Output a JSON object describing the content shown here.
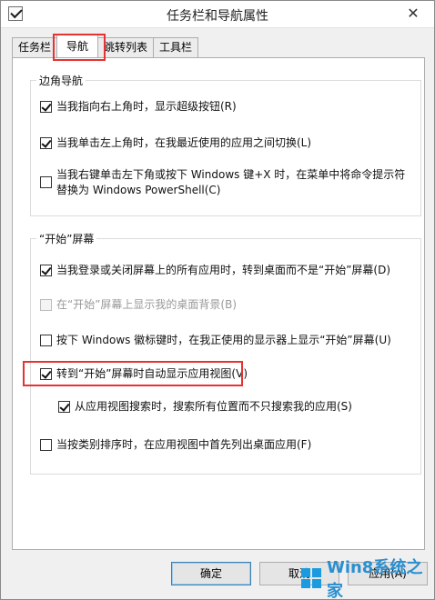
{
  "window": {
    "title": "任务栏和导航属性",
    "close_glyph": "✕"
  },
  "tabs": [
    {
      "label": "任务栏"
    },
    {
      "label": "导航"
    },
    {
      "label": "跳转列表"
    },
    {
      "label": "工具栏"
    }
  ],
  "corner_nav": {
    "title": "边角导航",
    "options": [
      {
        "label": "当我指向右上角时，显示超级按钮(R)",
        "checked": true
      },
      {
        "label": "当我单击左上角时，在我最近使用的应用之间切换(L)",
        "checked": true
      },
      {
        "label": "当我右键单击左下角或按下 Windows 键+X 时，在菜单中将命令提示符",
        "label2": "替换为 Windows PowerShell(C)",
        "checked": false
      }
    ]
  },
  "start_screen": {
    "title": "“开始”屏幕",
    "options": [
      {
        "label": "当我登录或关闭屏幕上的所有应用时，转到桌面而不是“开始”屏幕(D)",
        "checked": true
      },
      {
        "label": "在“开始”屏幕上显示我的桌面背景(B)",
        "checked": false,
        "disabled": true
      },
      {
        "label": "按下 Windows 徽标键时，在我正使用的显示器上显示“开始”屏幕(U)",
        "checked": false
      },
      {
        "label": "转到“开始”屏幕时自动显示应用视图(V)",
        "checked": true
      },
      {
        "label": "从应用视图搜索时，搜索所有位置而不只搜索我的应用(S)",
        "checked": true
      },
      {
        "label": "当按类别排序时，在应用视图中首先列出桌面应用(F)",
        "checked": false
      }
    ]
  },
  "buttons": {
    "ok": "确定",
    "cancel": "取消",
    "apply": "应用(A)"
  },
  "watermark": {
    "text": "Win8系统之家"
  },
  "colors": {
    "highlight": "#e53333",
    "watermark": "#2a8fd1"
  }
}
